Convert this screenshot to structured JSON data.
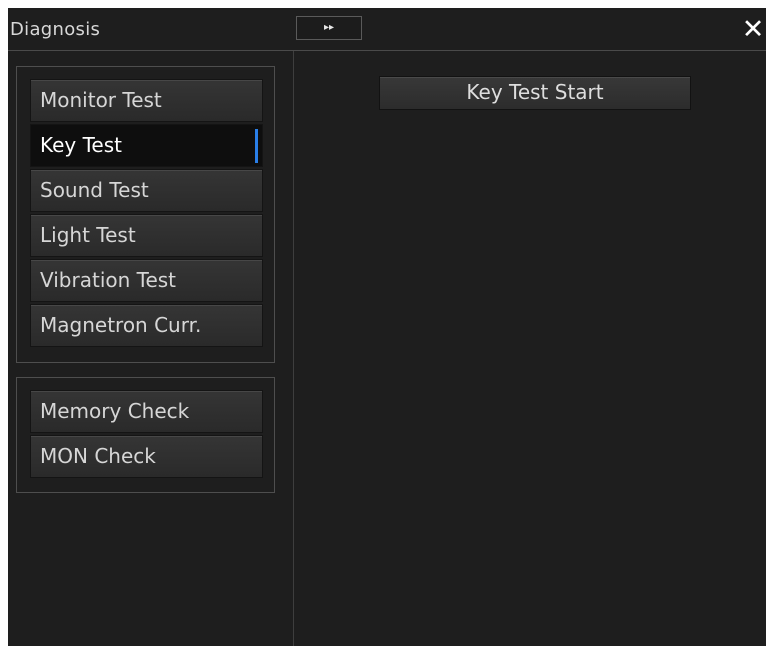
{
  "window": {
    "title": "Diagnosis",
    "expand_label": "▸▸",
    "close_label": "✕"
  },
  "menu": {
    "group1": [
      {
        "label": "Monitor Test",
        "active": false
      },
      {
        "label": "Key Test",
        "active": true
      },
      {
        "label": "Sound Test",
        "active": false
      },
      {
        "label": "Light Test",
        "active": false
      },
      {
        "label": "Vibration Test",
        "active": false
      },
      {
        "label": "Magnetron Curr.",
        "active": false
      }
    ],
    "group2": [
      {
        "label": "Memory Check",
        "active": false
      },
      {
        "label": "MON Check",
        "active": false
      }
    ]
  },
  "content": {
    "action_label": "Key Test Start"
  },
  "colors": {
    "background": "#1e1e1e",
    "button": "#2f2f2f",
    "active_button": "#0e0e0e",
    "accent": "#2a7fe8",
    "text": "#d6d6d6"
  }
}
